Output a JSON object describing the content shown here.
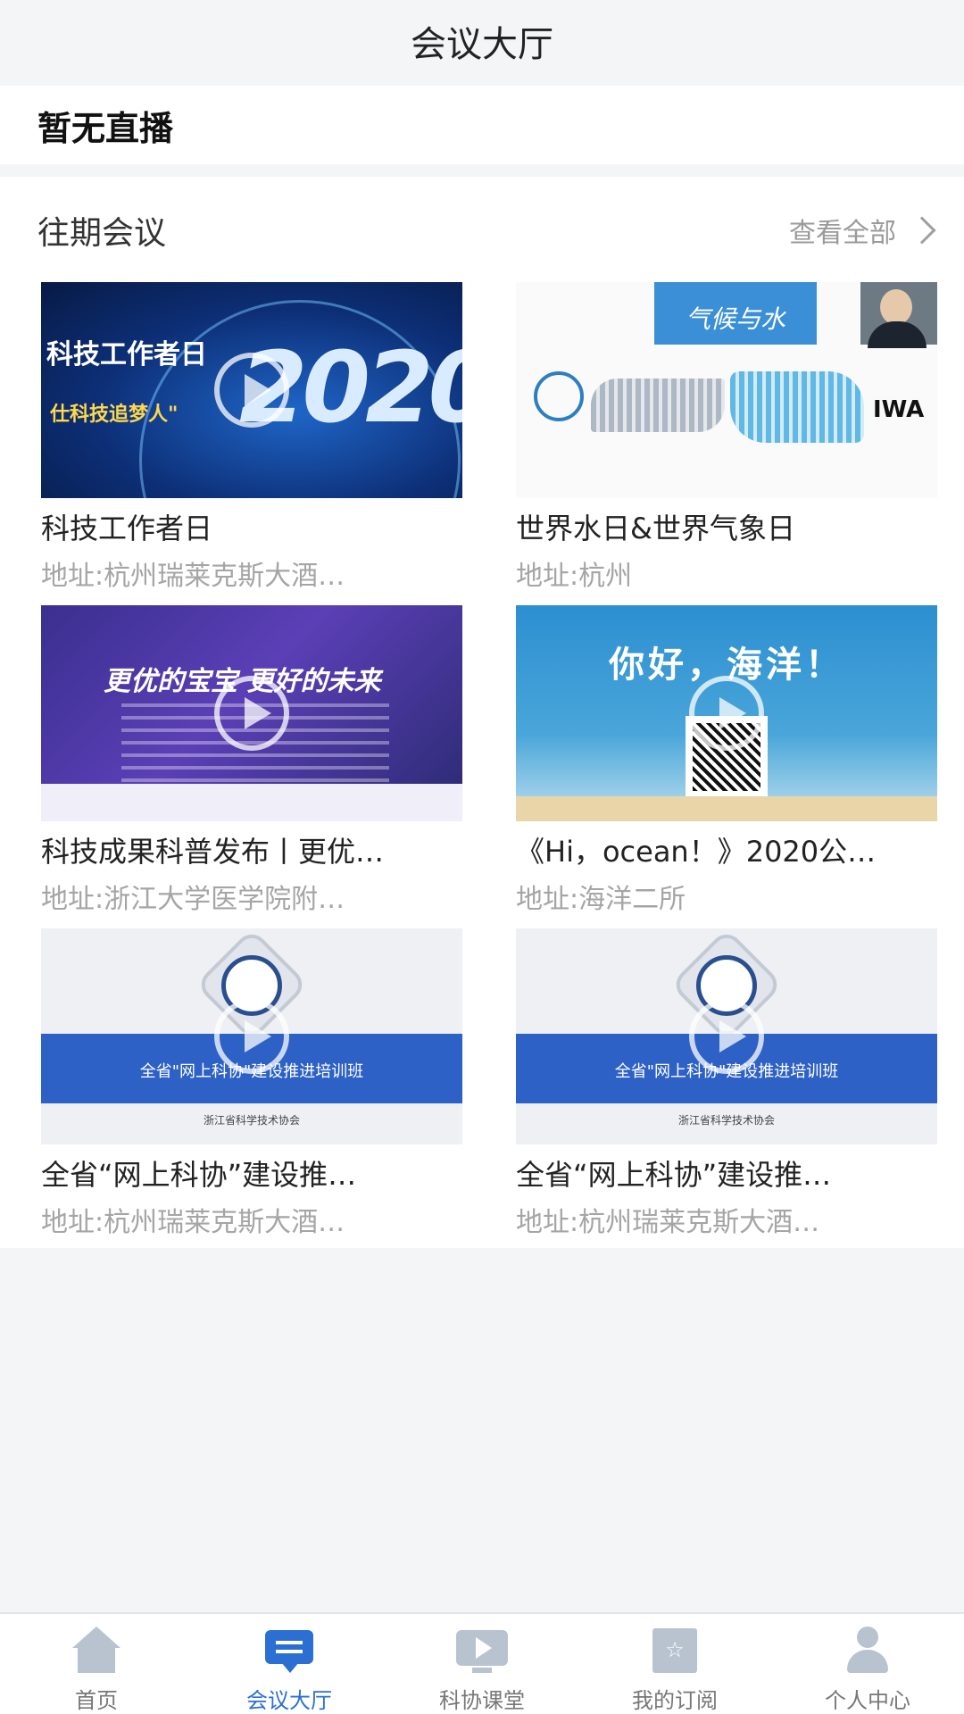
{
  "header": {
    "title": "会议大厅"
  },
  "live": {
    "status_text": "暂无直播"
  },
  "past": {
    "title": "往期会议",
    "view_all": "查看全部",
    "meetings": [
      {
        "title": "科技工作者日",
        "address": "地址:杭州瑞莱克斯大酒…",
        "thumb": {
          "tag": "科技工作者日",
          "big": "2020",
          "sub": "仕科技追梦人\""
        }
      },
      {
        "title": "世界水日&世界气象日",
        "address": "地址:杭州",
        "thumb": {
          "banner": "气候与水",
          "brand": "IWA"
        }
      },
      {
        "title": "科技成果科普发布丨更优…",
        "address": "地址:浙江大学医学院附…",
        "thumb": {
          "headline": "更优的宝宝 更好的未来"
        }
      },
      {
        "title": "《Hi，ocean！》2020公…",
        "address": "地址:海洋二所",
        "thumb": {
          "headline": "你好，海洋！"
        }
      },
      {
        "title": "全省“网上科协”建设推…",
        "address": "地址:杭州瑞莱克斯大酒…",
        "thumb": {
          "banner": "全省\"网上科协\"建设推进培训班",
          "footer": "浙江省科学技术协会"
        }
      },
      {
        "title": "全省“网上科协”建设推…",
        "address": "地址:杭州瑞莱克斯大酒…",
        "thumb": {
          "banner": "全省\"网上科协\"建设推进培训班",
          "footer": "浙江省科学技术协会"
        }
      }
    ]
  },
  "tabbar": {
    "active": "会议大厅",
    "tabs": [
      {
        "label": "首页",
        "icon": "home-icon"
      },
      {
        "label": "会议大厅",
        "icon": "chat-icon"
      },
      {
        "label": "科协课堂",
        "icon": "video-class-icon"
      },
      {
        "label": "我的订阅",
        "icon": "bookmark-star-icon"
      },
      {
        "label": "个人中心",
        "icon": "user-icon"
      }
    ]
  },
  "colors": {
    "accent": "#2b6fd3",
    "inactive": "#b9c3d0",
    "page_bg": "#f4f5f7"
  }
}
